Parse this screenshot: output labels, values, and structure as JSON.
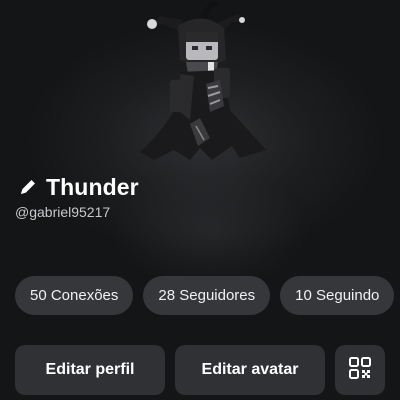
{
  "profile": {
    "display_name": "Thunder",
    "username": "@gabriel95217",
    "avatar_icon": "jester-avatar"
  },
  "stats": [
    {
      "label": "50 Conexões"
    },
    {
      "label": "28 Seguidores"
    },
    {
      "label": "10 Seguindo"
    }
  ],
  "actions": {
    "edit_profile": "Editar perfil",
    "edit_avatar": "Editar avatar",
    "qr_icon": "qr-code-icon"
  },
  "colors": {
    "background": "#1d1e20",
    "pill": "#35373b",
    "button": "#2f3135",
    "text": "#ffffff",
    "muted_text": "#c8c9cc"
  }
}
